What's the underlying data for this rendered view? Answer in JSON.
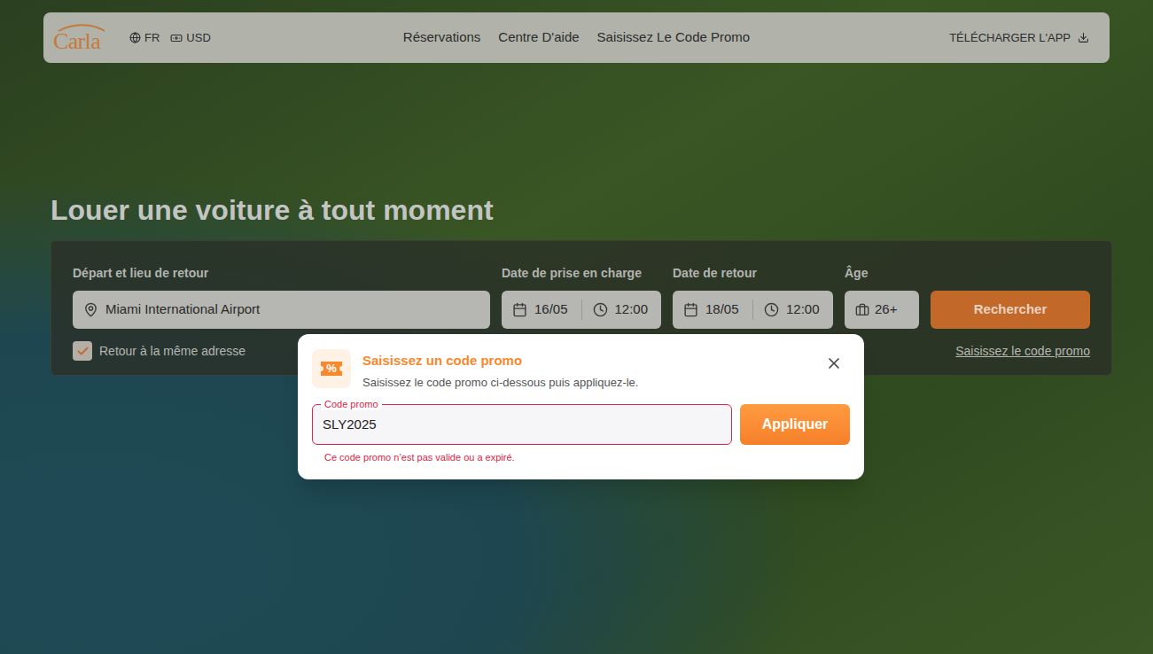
{
  "nav": {
    "logo": "Carla",
    "language": "FR",
    "currency": "USD",
    "links": [
      "Réservations",
      "Centre D'aide",
      "Saisissez Le Code Promo"
    ],
    "download": "TÉLÉCHARGER L'APP"
  },
  "hero": {
    "title": "Louer une voiture à tout moment"
  },
  "search": {
    "location_label": "Départ et lieu de retour",
    "location": "Miami International Airport",
    "pickup_label": "Date de prise en charge",
    "pickup_date": "16/05",
    "pickup_time": "12:00",
    "return_label": "Date de retour",
    "return_date": "18/05",
    "return_time": "12:00",
    "age_label": "Âge",
    "age": "26+",
    "button": "Rechercher",
    "same_return": {
      "label": "Retour à la même adresse",
      "checked": true
    },
    "promo_link": "Saisissez le code promo"
  },
  "modal": {
    "icon_glyph": "%",
    "title": "Saisissez un code promo",
    "subtitle": "Saisissez le code promo ci-dessous puis appliquez-le.",
    "field_label": "Code promo",
    "value": "SLY2025",
    "error": "Ce code promo n’est pas valide ou a expiré.",
    "button": "Appliquer"
  }
}
